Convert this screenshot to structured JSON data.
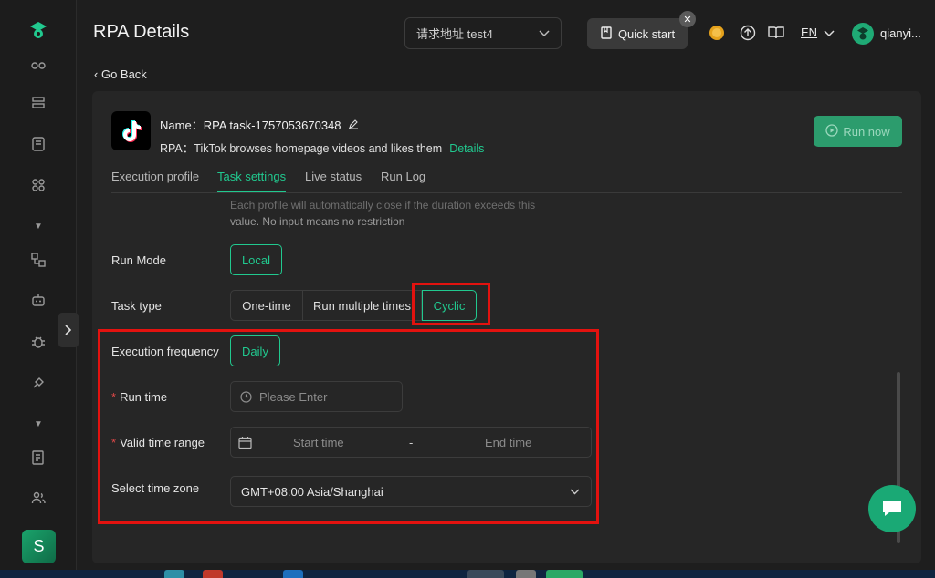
{
  "sidebar": {
    "avatar_letter": "S"
  },
  "header": {
    "title": "RPA Details",
    "address_value": "请求地址  test4",
    "quick_start": "Quick start",
    "language": "EN",
    "username": "qianyi..."
  },
  "go_back": "Go Back",
  "task": {
    "name_label": "Name：",
    "name_value": "RPA task-1757053670348",
    "rpa_label": "RPA：",
    "rpa_value": "TikTok browses homepage videos and likes them",
    "details_link": "Details",
    "run_now": "Run now"
  },
  "tabs": [
    {
      "label": "Execution profile"
    },
    {
      "label": "Task settings",
      "active": true
    },
    {
      "label": "Live status"
    },
    {
      "label": "Run Log"
    }
  ],
  "form": {
    "helper_line1": "Each profile will automatically close if the duration exceeds this",
    "helper_line2": "value. No input means no restriction",
    "run_mode_label": "Run Mode",
    "run_mode_value": "Local",
    "task_type_label": "Task type",
    "task_type_options": [
      "One-time",
      "Run multiple times",
      "Cyclic"
    ],
    "task_type_selected": "Cyclic",
    "exec_freq_label": "Execution frequency",
    "exec_freq_value": "Daily",
    "run_time_label": "Run time",
    "run_time_placeholder": "Please Enter",
    "valid_range_label": "Valid time range",
    "start_placeholder": "Start time",
    "range_sep": "-",
    "end_placeholder": "End time",
    "timezone_label": "Select time zone",
    "timezone_value": "GMT+08:00 Asia/Shanghai"
  },
  "colors": {
    "accent": "#21c98f",
    "highlight_box": "#e3120f",
    "background": "#1e1e1e",
    "card": "#262626"
  }
}
